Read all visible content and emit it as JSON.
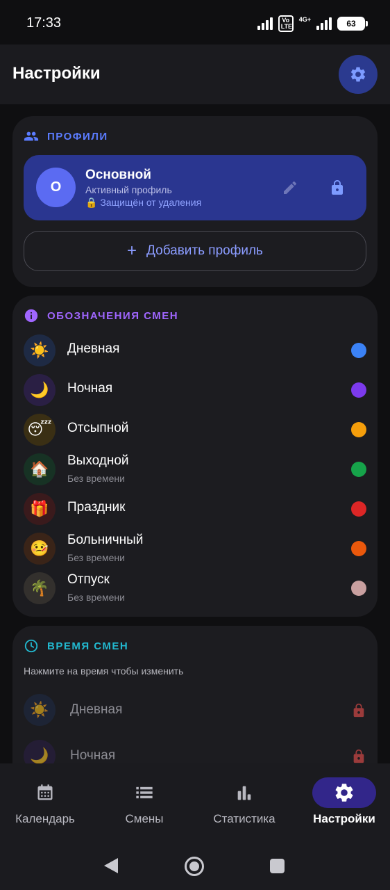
{
  "status_bar": {
    "time": "17:33",
    "volte": "Vo LTE",
    "network": "4G+",
    "battery": "63"
  },
  "app_bar": {
    "title": "Настройки",
    "settings_icon": "gear-icon",
    "accent": "#2b3a8f"
  },
  "profiles": {
    "section_title": "ПРОФИЛИ",
    "section_icon": "people-icon",
    "section_color": "#5b7cff",
    "active_profile": {
      "avatar_letter": "О",
      "name": "Основной",
      "subtitle": "Активный профиль",
      "protected_text": "🔒 Защищён от удаления",
      "edit_icon": "pencil-icon",
      "lock_icon": "lock-icon"
    },
    "add_button": {
      "plus": "+",
      "label": "Добавить профиль"
    }
  },
  "shift_types": {
    "section_title": "ОБОЗНАЧЕНИЯ СМЕН",
    "section_icon": "info-icon",
    "section_color": "#a066ff",
    "items": [
      {
        "emoji": "☀️",
        "name": "Дневная",
        "subtitle": "",
        "color": "#3b82f6",
        "bg": "#1e2a44"
      },
      {
        "emoji": "🌙",
        "name": "Ночная",
        "subtitle": "",
        "color": "#7c3aed",
        "bg": "#2a1f44"
      },
      {
        "emoji": "😴",
        "name": "Отсыпной",
        "subtitle": "",
        "color": "#f59e0b",
        "bg": "#3a2f14"
      },
      {
        "emoji": "🏠",
        "name": "Выходной",
        "subtitle": "Без времени",
        "color": "#16a34a",
        "bg": "#173224"
      },
      {
        "emoji": "🎁",
        "name": "Праздник",
        "subtitle": "",
        "color": "#dc2626",
        "bg": "#3a1a1c"
      },
      {
        "emoji": "🤒",
        "name": "Больничный",
        "subtitle": "Без времени",
        "color": "#ea580c",
        "bg": "#3a2418"
      },
      {
        "emoji": "🌴",
        "name": "Отпуск",
        "subtitle": "Без времени",
        "color": "#c9a0a0",
        "bg": "#33302d"
      }
    ]
  },
  "shift_times": {
    "section_title": "ВРЕМЯ СМЕН",
    "section_icon": "clock-icon",
    "section_color": "#22b8cf",
    "hint": "Нажмите на время чтобы изменить",
    "items": [
      {
        "emoji": "☀️",
        "name": "Дневная",
        "bg": "#1e2a44",
        "lock_icon": "lock-icon"
      },
      {
        "emoji": "🌙",
        "name": "Ночная",
        "bg": "#2a1f44",
        "lock_icon": "lock-icon"
      }
    ]
  },
  "bottom_nav": {
    "items": [
      {
        "icon": "calendar-icon",
        "label": "Календарь",
        "active": false
      },
      {
        "icon": "list-icon",
        "label": "Смены",
        "active": false
      },
      {
        "icon": "bar-chart-icon",
        "label": "Статистика",
        "active": false
      },
      {
        "icon": "gear-icon",
        "label": "Настройки",
        "active": true
      }
    ]
  }
}
